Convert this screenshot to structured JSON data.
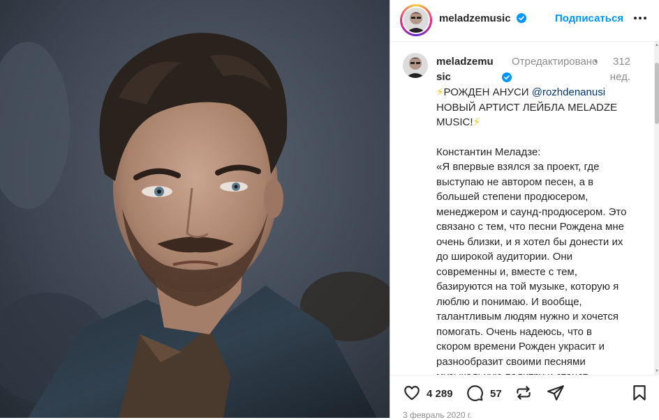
{
  "header": {
    "username": "meladzemusic",
    "follow_label": "Подписаться"
  },
  "caption": {
    "username": "meladzemusic",
    "edited": "Отредактировано",
    "time": "312 нед.",
    "line1_text": "РОЖДЕН АНУСИ ",
    "mention": "@rozhdenanusi",
    "line2_text": "НОВЫЙ АРТИСТ ЛЕЙБЛА MELADZE MUSIC!",
    "bolt": "⚡",
    "author": "Константин Меладзе:",
    "quote": "«Я впервые взялся за проект, где выступаю не автором песен, а в большей степени продюсером, менеджером и саунд-продюсером. Это связано с тем, что песни Рождена мне очень близки, и я хотел бы донести их до широкой аудитории. Они современны и, вместе с тем, базируются на той музыке, которую я люблю и понимаю. И вообще, талантливым людям нужно и хочется помогать. Очень надеюсь, что в скором времени Рожден украсит и разнообразит своими песнями музыкальную палитру и станет"
  },
  "actions": {
    "likes": "4 289",
    "comments": "57",
    "date": "3 февраль 2020 г."
  },
  "colors": {
    "accent": "#0095f6",
    "verified": "#0095f6",
    "mention": "#00376b",
    "muted": "#8e8e8e"
  },
  "icons": [
    "verified-badge-icon",
    "more-icon",
    "heart-icon",
    "comment-icon",
    "repost-icon",
    "share-icon",
    "bookmark-icon"
  ]
}
